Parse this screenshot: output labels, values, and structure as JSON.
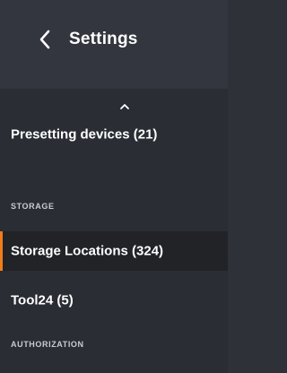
{
  "header": {
    "title": "Settings",
    "back_icon": "chevron-left-icon"
  },
  "nav": {
    "scroll_icon": "chevron-up-icon",
    "items": [
      {
        "label": "Presetting devices (21)",
        "active": false
      },
      {
        "label": "Storage Locations (324)",
        "active": true
      },
      {
        "label": "Tool24 (5)",
        "active": false
      }
    ],
    "sections": [
      {
        "label": "STORAGE"
      },
      {
        "label": "AUTHORIZATION"
      }
    ]
  },
  "colors": {
    "accent": "#f07d1a",
    "header_bg": "#33363e",
    "nav_bg": "#2a2d33",
    "active_bg": "#212327"
  }
}
